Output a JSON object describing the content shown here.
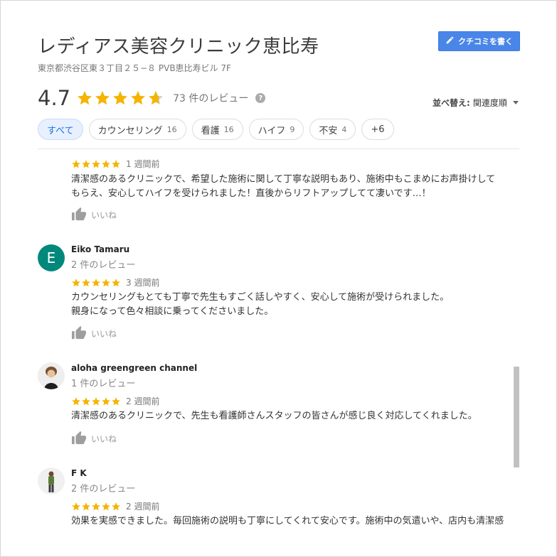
{
  "header": {
    "title": "レディアス美容クリニック恵比寿",
    "address": "東京都渋谷区東３丁目２５−８ PVB恵比寿ビル 7F",
    "write_review_label": "クチコミを書く",
    "write_icon": "pencil-icon"
  },
  "summary": {
    "rating": "4.7",
    "rating_value": 4.7,
    "review_count_label": "73 件のレビュー",
    "help_glyph": "?"
  },
  "sort": {
    "label": "並べ替え:",
    "value": "関連度順"
  },
  "filters": [
    {
      "label": "すべて",
      "count": "",
      "active": true
    },
    {
      "label": "カウンセリング",
      "count": "16",
      "active": false
    },
    {
      "label": "看護",
      "count": "16",
      "active": false
    },
    {
      "label": "ハイフ",
      "count": "9",
      "active": false
    },
    {
      "label": "不安",
      "count": "4",
      "active": false
    },
    {
      "label": "+6",
      "count": "",
      "active": false
    }
  ],
  "reviews": [
    {
      "author": "",
      "meta": "",
      "stars": 5,
      "when": "1 週間前",
      "text_lines": [
        "清潔感のあるクリニックで、希望した施術に関して丁寧な説明もあり、施術中もこまめにお声掛けして",
        "もらえ、安心してハイフを受けられました！直後からリフトアップしてて凄いです…！"
      ],
      "like_label": "いいね"
    },
    {
      "author": "Eiko Tamaru",
      "avatar_letter": "E",
      "avatar_color": "#00897b",
      "meta": "2 件のレビュー",
      "stars": 5,
      "when": "3 週間前",
      "text_lines": [
        "カウンセリングもとても丁寧で先生もすごく話しやすく、安心して施術が受けられました。",
        "親身になって色々相談に乗ってくださいました。"
      ],
      "like_label": "いいね"
    },
    {
      "author": "aloha greengreen channel",
      "meta": "1 件のレビュー",
      "stars": 5,
      "when": "2 週間前",
      "text_lines": [
        "清潔感のあるクリニックで、先生も看護師さんスタッフの皆さんが感じ良く対応してくれました。"
      ],
      "like_label": "いいね"
    },
    {
      "author": "F K",
      "meta": "2 件のレビュー",
      "stars": 5,
      "when": "2 週間前",
      "text_lines": [
        "効果を実感できました。毎回施術の説明も丁寧にしてくれて安心です。施術中の気遣いや、店内も清潔感"
      ],
      "like_label": ""
    }
  ],
  "colors": {
    "star": "#f4b400",
    "accent": "#4a86e8",
    "chip_active": "#1a73e8"
  }
}
